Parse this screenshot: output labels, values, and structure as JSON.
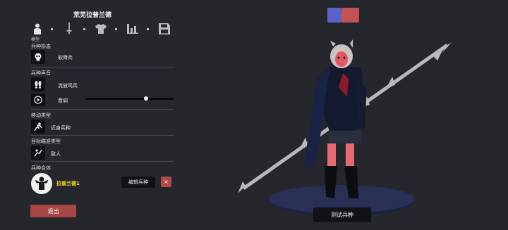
{
  "title": "荒芜拉普兰德",
  "tabs": [
    {
      "label": "模型",
      "icon": "person-icon"
    },
    {
      "label": "",
      "icon": "sword-icon"
    },
    {
      "label": "",
      "icon": "shirt-icon"
    },
    {
      "label": "",
      "icon": "bars-icon"
    },
    {
      "label": "",
      "icon": "save-icon"
    }
  ],
  "sections": {
    "form": {
      "heading": "兵种形态",
      "value": "软骨兵",
      "icon": "skull-icon"
    },
    "voice": {
      "heading": "兵种声音",
      "value": "流放鸣兵",
      "icon": "feet-icon",
      "pitch_label": "音调",
      "pitch_icon": "play-icon",
      "pitch_value": 0.69
    },
    "movement": {
      "heading": "移动类型",
      "value": "近身兵种",
      "icon": "running-icon"
    },
    "target": {
      "heading": "目标瞄准类型",
      "value": "敌人",
      "icon": "target-icon"
    },
    "combo": {
      "heading": "兵种合体",
      "unit_name": "拉普兰德1",
      "icon": "strongman-icon",
      "edit_label": "编辑兵种",
      "delete_label": "×"
    }
  },
  "exit_label": "退出",
  "test_label": "测试兵种",
  "color_swatches": [
    {
      "color": "#5b62c6"
    },
    {
      "color": "#c35256"
    }
  ]
}
